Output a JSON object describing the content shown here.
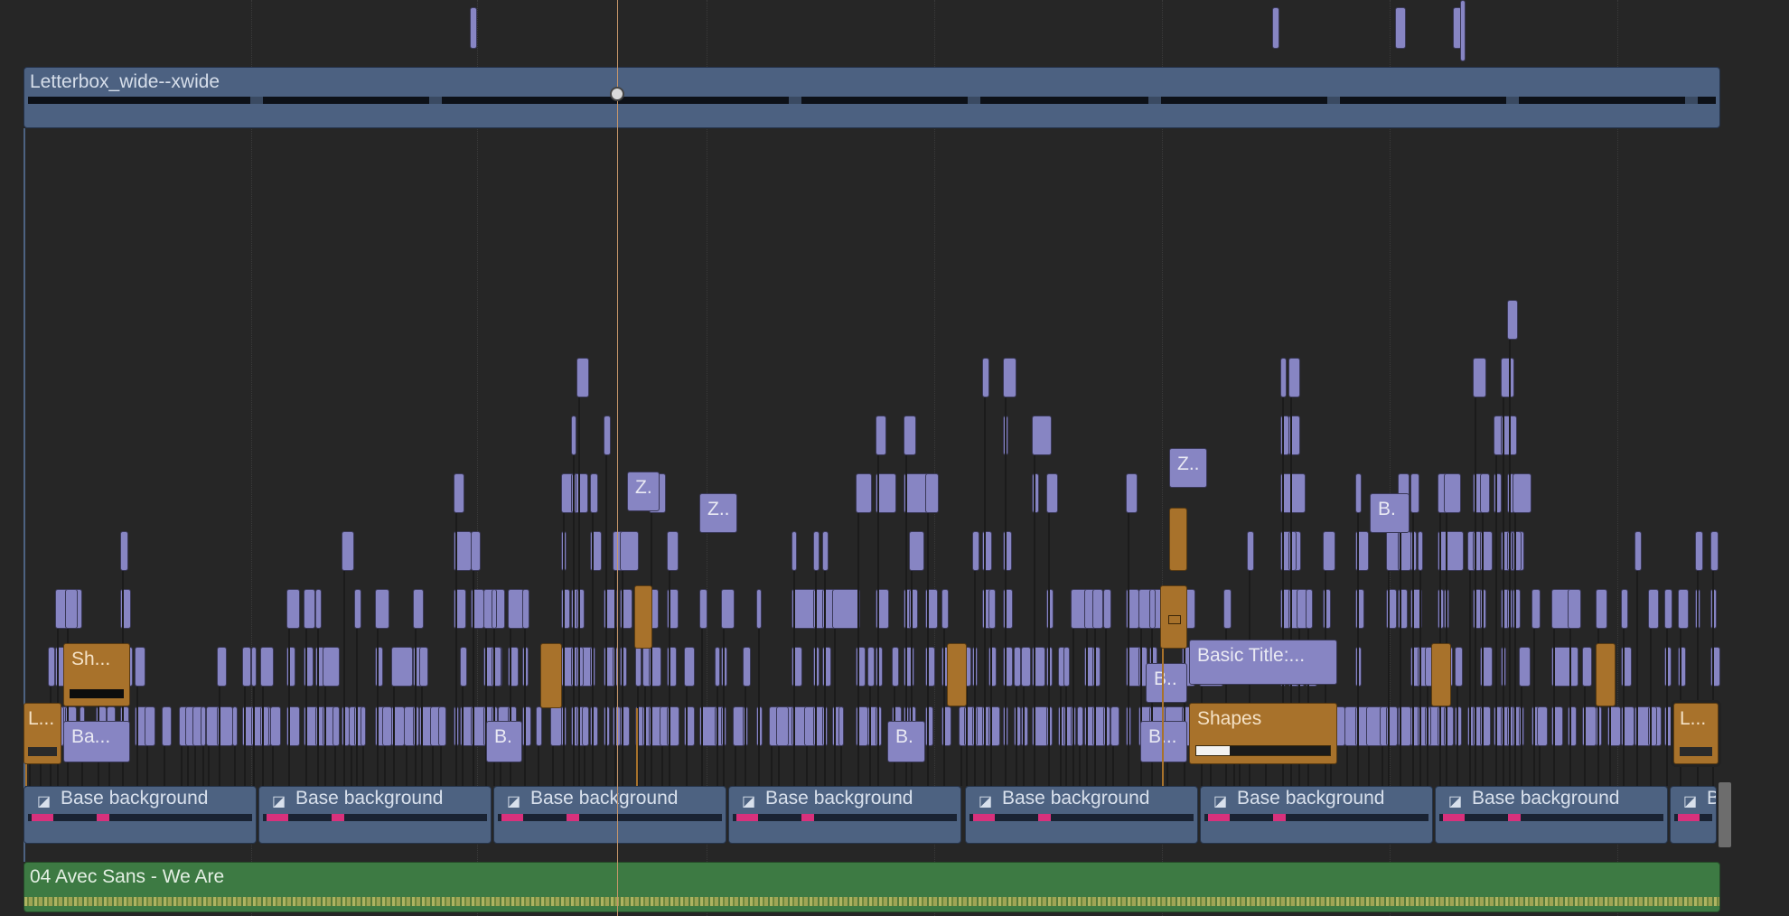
{
  "timeline": {
    "adjustment_clip": {
      "label": "Letterbox_wide--xwide"
    },
    "titles": [
      {
        "key": "z1",
        "label": "Z."
      },
      {
        "key": "z2",
        "label": "Z.."
      },
      {
        "key": "z3",
        "label": "Z.."
      },
      {
        "key": "b_r",
        "label": "B."
      },
      {
        "key": "b_b1",
        "label": "B.."
      },
      {
        "key": "b_b2",
        "label": "B..."
      },
      {
        "key": "basic",
        "label": "Basic Title:..."
      },
      {
        "key": "ba",
        "label": "Ba..."
      },
      {
        "key": "b_a",
        "label": "B."
      },
      {
        "key": "b_c",
        "label": "B."
      },
      {
        "key": "sh",
        "label": "Sh..."
      },
      {
        "key": "l1",
        "label": "L..."
      },
      {
        "key": "l2",
        "label": "L..."
      },
      {
        "key": "shapes",
        "label": "Shapes"
      }
    ],
    "shapes_progress": 0.25,
    "background_clips": [
      {
        "label": "Base background"
      },
      {
        "label": "Base background"
      },
      {
        "label": "Base background"
      },
      {
        "label": "Base background"
      },
      {
        "label": "Base background"
      },
      {
        "label": "Base background"
      },
      {
        "label": "Base background"
      },
      {
        "label": "B"
      }
    ],
    "audio_clip": {
      "label": "04 Avec Sans - We Are"
    }
  },
  "colors": {
    "title_clip": "#8785c3",
    "generator_clip": "#a8722b",
    "adjustment_clip": "#4c6181",
    "audio_clip": "#3d7a43",
    "playhead": "#c7966a"
  },
  "icons": {
    "background_clip": "film-clip-icon",
    "playhead": "playhead-knob"
  }
}
